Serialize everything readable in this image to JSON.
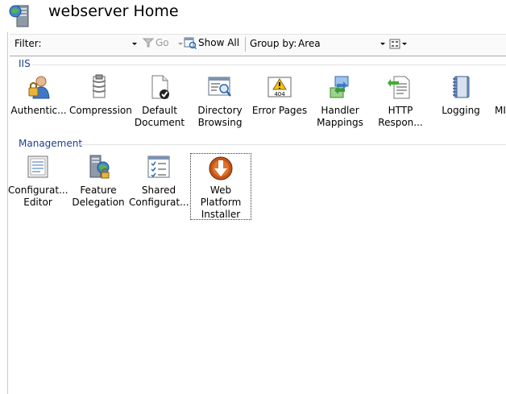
{
  "window": {
    "title": "webserver Home"
  },
  "toolbar": {
    "filter_label": "Filter:",
    "filter_value": "",
    "go_label": "Go",
    "show_all_label": "Show All",
    "group_by_label": "Group by:",
    "group_by_value": "Area"
  },
  "groups": {
    "iis": {
      "label": "IIS",
      "items": [
        {
          "label": "Authentic...",
          "icon": "authentication-icon"
        },
        {
          "label": "Compression",
          "icon": "compression-icon"
        },
        {
          "label": "Default Document",
          "icon": "default-document-icon"
        },
        {
          "label": "Directory Browsing",
          "icon": "directory-browsing-icon"
        },
        {
          "label": "Error Pages",
          "icon": "error-pages-icon"
        },
        {
          "label": "Handler Mappings",
          "icon": "handler-mappings-icon"
        },
        {
          "label": "HTTP Respon...",
          "icon": "http-response-icon"
        },
        {
          "label": "Logging",
          "icon": "logging-icon"
        },
        {
          "label": "MI",
          "icon": "mime-types-icon"
        }
      ]
    },
    "management": {
      "label": "Management",
      "items": [
        {
          "label": "Configurat... Editor",
          "icon": "configuration-editor-icon"
        },
        {
          "label": "Feature Delegation",
          "icon": "feature-delegation-icon"
        },
        {
          "label": "Shared Configurat...",
          "icon": "shared-configuration-icon"
        },
        {
          "label": "Web Platform Installer",
          "icon": "web-platform-installer-icon",
          "selected": true
        }
      ]
    }
  }
}
